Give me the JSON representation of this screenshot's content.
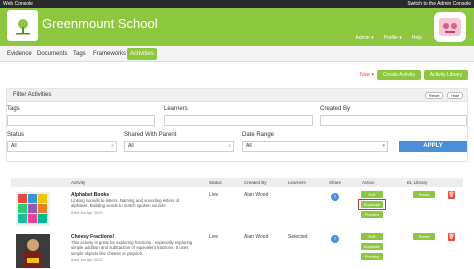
{
  "topbar": {
    "left": "Web Console",
    "right": "Switch to the Admin Console"
  },
  "header": {
    "school_name": "Greenmount School",
    "links": [
      "Admin",
      "Profile",
      "Help"
    ]
  },
  "tabs": [
    "Evidence",
    "Documents",
    "Tags",
    "Frameworks",
    "Activities"
  ],
  "active_tab": "Activities",
  "actions": {
    "now": "Now",
    "create": "Create Activity",
    "library": "Activity Library"
  },
  "filter": {
    "title": "Filter Activities",
    "reset": "Reset",
    "hide": "Hide",
    "labels": {
      "tags": "Tags",
      "learners": "Learners",
      "created_by": "Created By",
      "status": "Status",
      "shared": "Shared With Parent",
      "date_range": "Date Range"
    },
    "status_value": "All",
    "shared_value": "All",
    "date_value": "All",
    "apply": "APPLY"
  },
  "table": {
    "headers": [
      "Activity",
      "Status",
      "Created By",
      "Learners",
      "Share",
      "Action",
      "EL Library"
    ],
    "rows": [
      {
        "title": "Alphabet Books",
        "desc": "Linking sounds to letters. Naming and sounding letters of alphabet. Building words to match spoken sounds",
        "date": "Wed 1st Apr 2020",
        "status": "Live",
        "created_by": "Alan Wood",
        "learners": "",
        "actions": [
          "Edit",
          "Duplicate",
          "Preview"
        ],
        "library": "Share"
      },
      {
        "title": "Cheesy Fractions!",
        "desc": "This activity is great for exploring fractions - especially exploring simple addition and subtraction of equivalent fractions. It uses simple objects like cheese or playdoh.",
        "date": "Wed 1st Apr 2020",
        "status": "Live",
        "created_by": "Alan Wood",
        "learners": "Selected",
        "actions": [
          "Edit",
          "Duplicate",
          "Preview"
        ],
        "library": "Share"
      }
    ]
  },
  "colors": {
    "brand": "#8dc63f",
    "apply": "#4a90d9",
    "delete": "#e74c3c",
    "highlight": "#c0392b"
  }
}
